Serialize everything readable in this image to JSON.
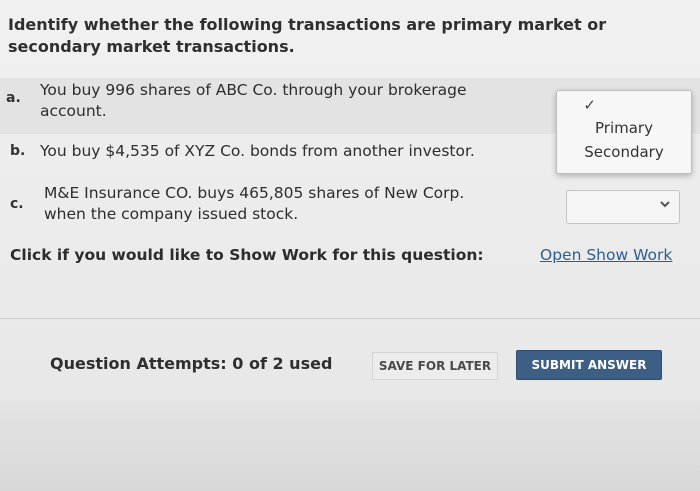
{
  "question": {
    "text": "Identify whether the following transactions are primary market or secondary market transactions."
  },
  "items": [
    {
      "letter": "a.",
      "line1": "You buy 996 shares of ABC Co. through your brokerage",
      "line2": "account."
    },
    {
      "letter": "b.",
      "line1": "You buy $4,535 of XYZ Co. bonds from another investor."
    },
    {
      "letter": "c.",
      "line1": "M&E Insurance CO. buys 465,805 shares of New Corp.",
      "line2": "when the company issued stock."
    }
  ],
  "dropdown": {
    "check_glyph": "✓",
    "options": [
      "Primary",
      "Secondary"
    ],
    "chevron_icon": "chevron-down-icon"
  },
  "show_work": {
    "prompt": "Click if you would like to Show Work for this question:",
    "link": "Open Show Work"
  },
  "footer": {
    "attempts": "Question Attempts: 0 of 2 used",
    "save_label": "SAVE FOR LATER",
    "submit_label": "SUBMIT ANSWER"
  },
  "colors": {
    "submit_bg": "#3d5f86",
    "link": "#2b5f8f"
  }
}
